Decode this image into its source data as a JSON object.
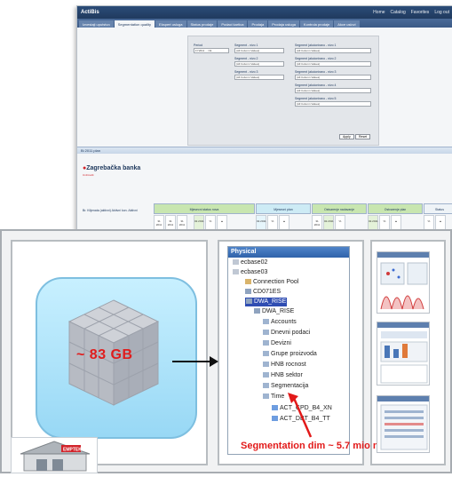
{
  "app": {
    "logo": "ActiBis",
    "top_links": [
      "Home",
      "Catalog",
      "Favorites",
      "Log out"
    ]
  },
  "tabs": [
    "Izvestaji uputstvo",
    "Segmentation quality",
    "Ekspert usluga",
    "Status prodaje",
    "Podaci kartica",
    "Prodaja",
    "Prodaja usluga",
    "Kontrola prodaje",
    "Akce uslovi"
  ],
  "filters": {
    "c1_label": "Period",
    "c1_value": "FY2011 ... Ok",
    "c2_labels": [
      "Segment - nivo 1",
      "Segment - nivo 2",
      "Segment - nivo 3"
    ],
    "c3_labels": [
      "Segment (akcionirano - nivo 1",
      "Segment (akcionirano - nivo 2",
      "Segment (akcionirano - nivo 3",
      "Segment (akcionirano - nivo 4",
      "Segment (akcionirano - nivo 5"
    ],
    "select_value": "(All Column Values)",
    "apply_button": "Apply",
    "reset_button": "Reset"
  },
  "panel_title": "Bi 2011 plan",
  "report": {
    "logo_text": "Zagrebačka banka",
    "sub_text": "UniCredit",
    "table_left_label": "Br. Klijenata (aktivni) Aktivni kon. Aktivni",
    "group_headers": [
      "Mjesecni status nova",
      "Mjesecni plan",
      "Ostvarenje nadavanje",
      "Ostvarenje plan",
      "Status"
    ],
    "cells": [
      "31 2011",
      "31 2011",
      "31 2011",
      "02.2011",
      "%",
      "▲"
    ]
  },
  "front": {
    "cube_label": "~ 83 GB",
    "tree_title": "Physical",
    "tree_nodes": [
      "ecbase02",
      "ecbase03",
      "Connection Pool",
      "CD071ES",
      "DWA_RISE",
      "DWA_RISE",
      "Accounts",
      "Dnevni podaci",
      "Devizni",
      "Grupe proizvoda",
      "HNB rocnost",
      "HNB sektor",
      "Segmentacija",
      "Time",
      "ACT_CPD_B4_XN",
      "ACT_DBT_B4_TT"
    ],
    "annotation": "Segmentation dim ~ 5.7 mio members",
    "corner_logo_text": "EMPTEK"
  },
  "colors": {
    "accent": "#2f62aa",
    "annotation": "#e21a1a",
    "cube_bg": "#98d8f5"
  }
}
